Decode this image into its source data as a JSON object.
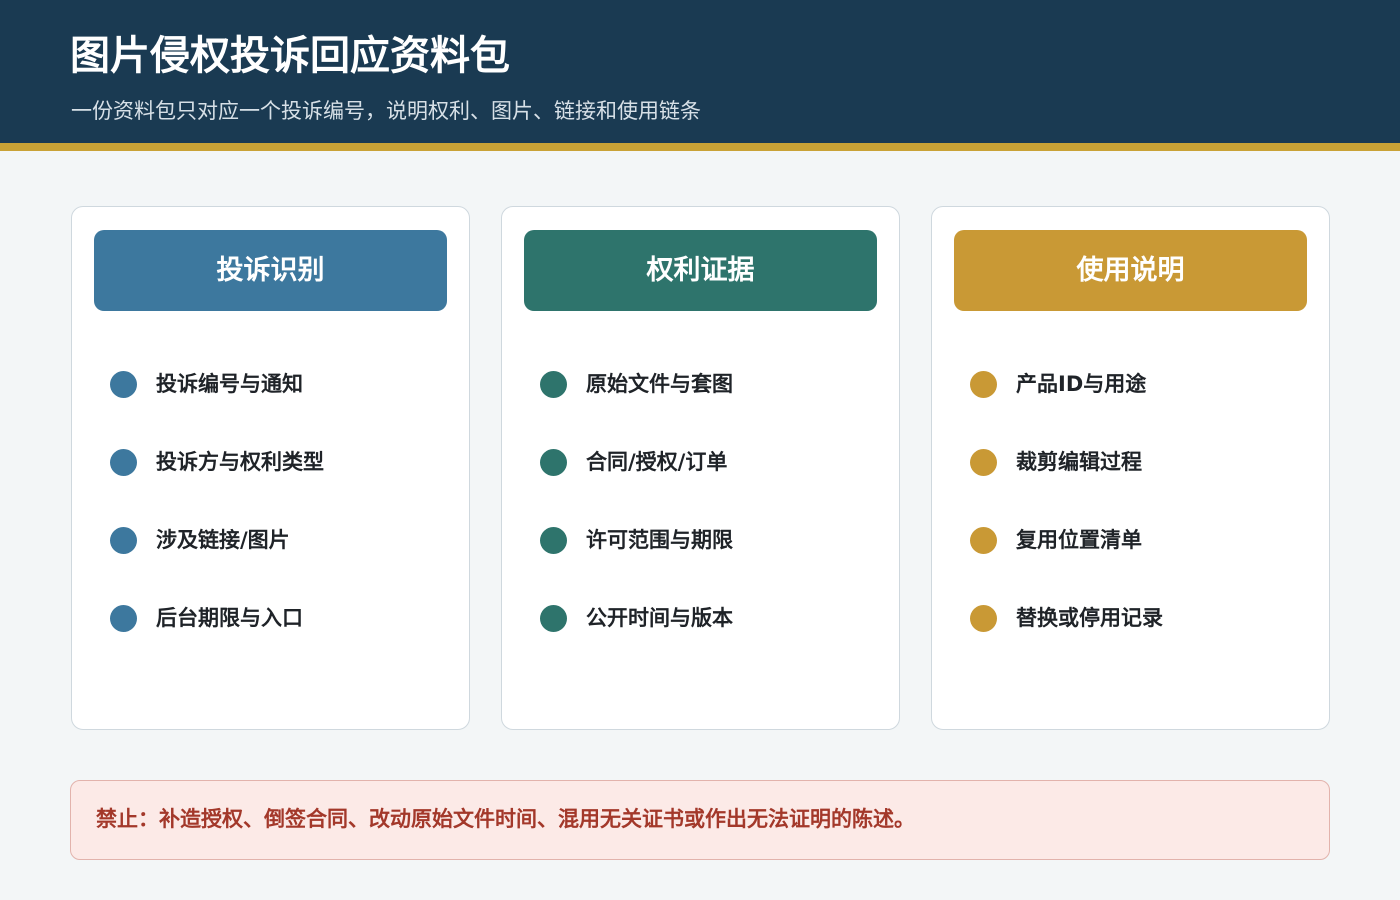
{
  "header": {
    "title": "图片侵权投诉回应资料包",
    "subtitle": "一份资料包只对应一个投诉编号，说明权利、图片、链接和使用链条"
  },
  "cards": [
    {
      "title": "投诉识别",
      "color": "#3d789e",
      "items": [
        "投诉编号与通知",
        "投诉方与权利类型",
        "涉及链接/图片",
        "后台期限与入口"
      ]
    },
    {
      "title": "权利证据",
      "color": "#2e746c",
      "items": [
        "原始文件与套图",
        "合同/授权/订单",
        "许可范围与期限",
        "公开时间与版本"
      ]
    },
    {
      "title": "使用说明",
      "color": "#c99935",
      "items": [
        "产品ID与用途",
        "裁剪编辑过程",
        "复用位置清单",
        "替换或停用记录"
      ]
    }
  ],
  "warning": {
    "text": "禁止：补造授权、倒签合同、改动原始文件时间、混用无关证书或作出无法证明的陈述。"
  }
}
